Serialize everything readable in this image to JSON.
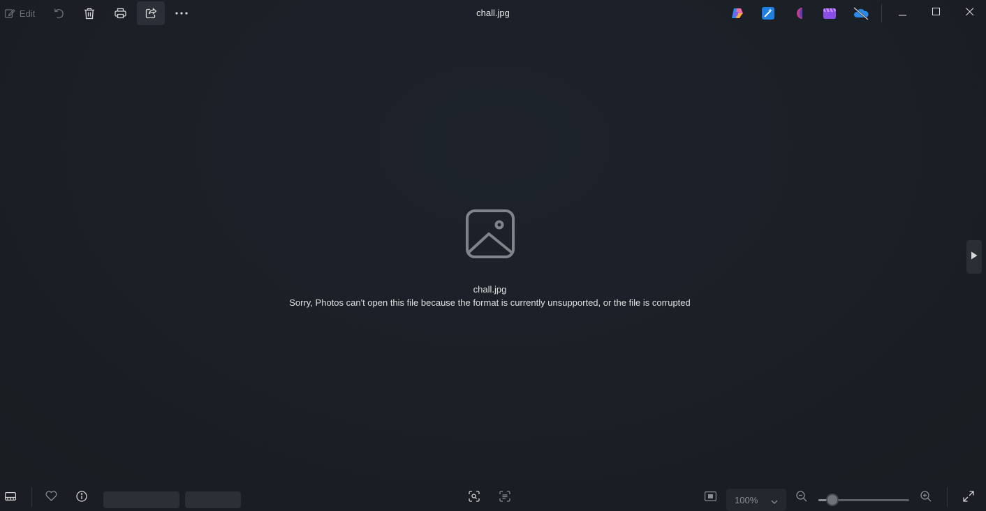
{
  "title_bar": {
    "filename": "chall.jpg"
  },
  "toolbar": {
    "edit_label": "Edit",
    "icons": [
      "edit-icon",
      "rotate-icon",
      "delete-icon",
      "print-icon",
      "share-icon",
      "more-icon"
    ]
  },
  "app_icons": [
    "copilot-icon",
    "designer-icon",
    "clipchamp-icon",
    "video-editor-icon",
    "onedrive-icon"
  ],
  "window_controls": [
    "minimize-icon",
    "maximize-icon",
    "close-icon"
  ],
  "message": {
    "filename": "chall.jpg",
    "error": "Sorry, Photos can't open this file because the format is currently unsupported, or the file is corrupted"
  },
  "bottom_bar": {
    "zoom_value": "100%",
    "zoom_slider_level": 0.15
  },
  "colors": {
    "background": "#1b1f26",
    "toolbar_active": "#2b3038",
    "text": "#e0e0e0"
  }
}
